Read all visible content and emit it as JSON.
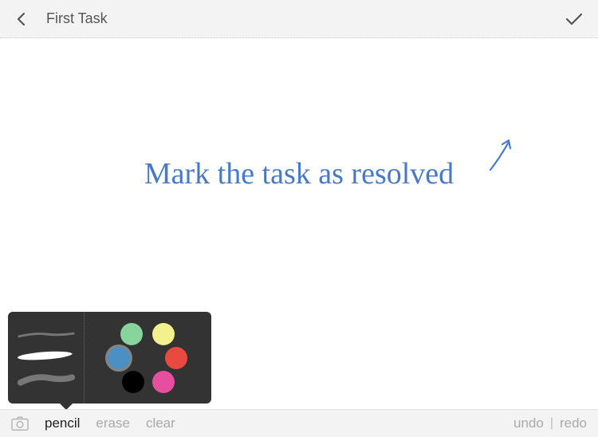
{
  "header": {
    "title": "First Task"
  },
  "annotation": {
    "text": "Mark the task as resolved"
  },
  "popover": {
    "colors": {
      "green": "#87d49c",
      "yellow": "#f3f18b",
      "blue": "#4a90c4",
      "red": "#e94a3f",
      "black": "#000000",
      "pink": "#e84e9f"
    },
    "selected_color": "blue",
    "selected_brush": 2
  },
  "toolbar": {
    "pencil": "pencil",
    "erase": "erase",
    "clear": "clear",
    "undo": "undo",
    "redo": "redo",
    "divider": "|",
    "active_tool": "pencil"
  }
}
